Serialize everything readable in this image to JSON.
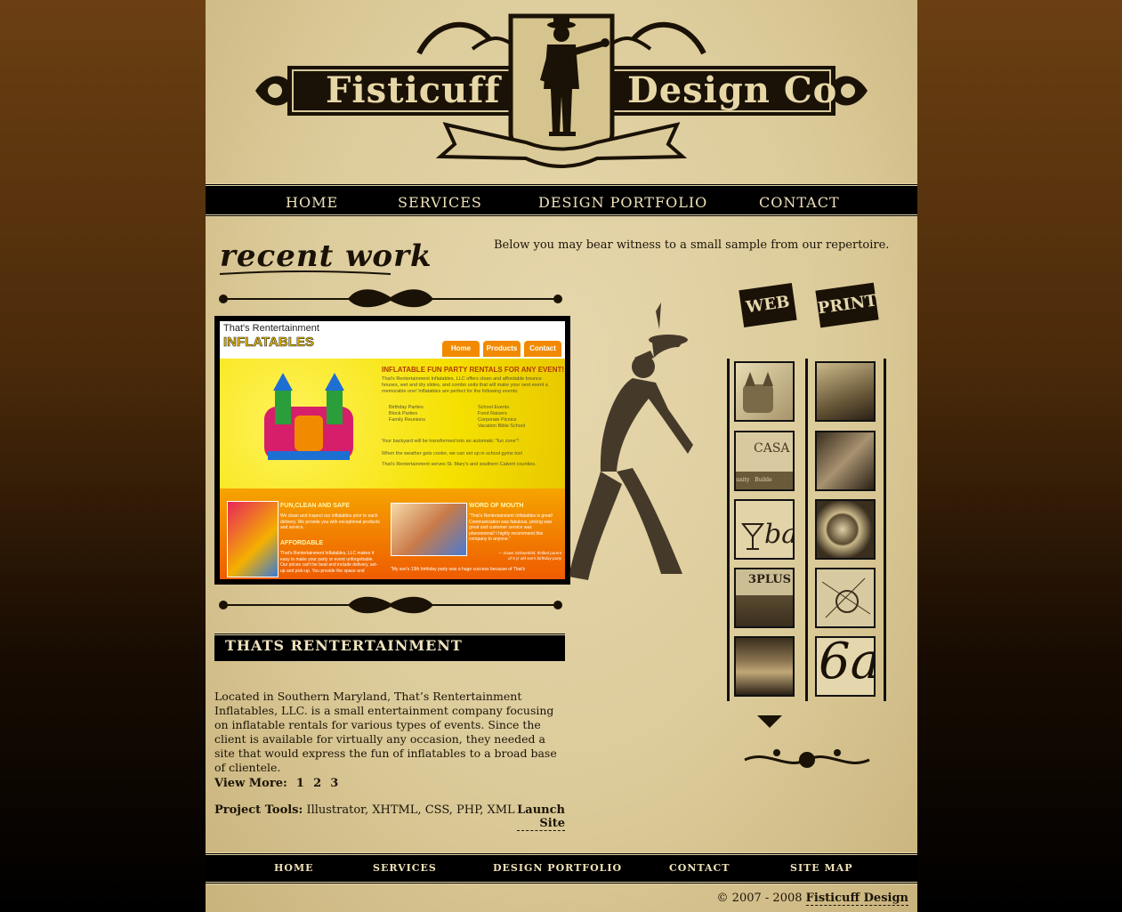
{
  "header": {
    "logo_left": "Fisticuff",
    "logo_right": "Design Co"
  },
  "nav": {
    "items": [
      "HOME",
      "SERVICES",
      "DESIGN PORTFOLIO",
      "CONTACT"
    ]
  },
  "section": {
    "title": "recent work",
    "intro": "Below you may bear witness to a small sample from our repertoire."
  },
  "preview": {
    "brand_line1": "That's Rentertainment",
    "brand_line2": "INFLATABLES",
    "tabs": [
      "Home",
      "Products",
      "Contact"
    ],
    "headline": "INFLATABLE FUN PARTY RENTALS FOR ANY EVENT!",
    "body": "That's Rentertainment Inflatables, LLC offers clean and affordable bounce houses, wet and dry slides, and combo units that will make your next event a memorable one! Inflatables are perfect for the following events:",
    "list_left": [
      "Birthday Parties",
      "Block Parties",
      "Family Reunions"
    ],
    "list_right": [
      "School Events",
      "Fund Raisers",
      "Corporate Picnics",
      "Vacation Bible School"
    ],
    "p2": "Your backyard will be transformed into an automatic \"fun zone\"!",
    "p3": "When the weather gets cooler, we can set up in school gyms too!",
    "p4": "That's Rentertainment serves St. Mary's and southern Calvert counties.",
    "box1_title": "FUN,CLEAN AND SAFE",
    "box1_text": "We clean and inspect our inflatables prior to each delivery. We provide you with exceptional products and service.",
    "box1_title2": "AFFORDABLE",
    "box1_text2": "That's Rentertainment Inflatables, LLC makes it easy to make your party or event unforgettable. Our prices can't be beat and include delivery, set-up and pick-up. You provide the space and",
    "box2_title": "WORD OF MOUTH",
    "box2_text": "\"That's Rentertainment Inflatables is great! Communication was fabulous, pricing was great and customer service was phenomenal! I highly recommend this company to anyone.\"",
    "box2_cite": "— Dawn Schoenfeld, thrilled parent",
    "box2_cite2": "of 9 yr old son's birthday party",
    "box2_text2": "\"My son's 13th birthday party was a huge success because of That's"
  },
  "project": {
    "title": "THATS RENTERTAINMENT",
    "description": "Located in Southern Maryland, That’s Rentertainment Inflatables, LLC. is a small entertainment company focusing on inflatable rentals for various types of events. Since the client is available for virtually any occasion, they needed a site that would express the fun of inflatables to a broad base of clientele.",
    "view_more_label": "View More:",
    "pages": [
      "1",
      "2",
      "3"
    ],
    "tools_label": "Project Tools:",
    "tools": "Illustrator, XHTML, CSS, PHP, XML",
    "launch_label": "Launch Site"
  },
  "sidebar": {
    "tab_web": "WEB",
    "tab_print": "PRINT",
    "thumb_casa": "CASA",
    "thumb_casa_sub": "unity   Builde",
    "thumb_3plus": "3PLUS",
    "thumb_ba": "ba",
    "thumb_6a": "6a"
  },
  "footer": {
    "items": [
      "HOME",
      "SERVICES",
      "DESIGN PORTFOLIO",
      "CONTACT",
      "SITE MAP"
    ],
    "copyright": "© 2007 - 2008",
    "copyright_brand": "Fisticuff Design"
  },
  "colors": {
    "paper": "#dccb9a",
    "ink": "#1a1206",
    "banner_text": "#e7d7a7",
    "outer_bg_top": "#6b3f12"
  }
}
